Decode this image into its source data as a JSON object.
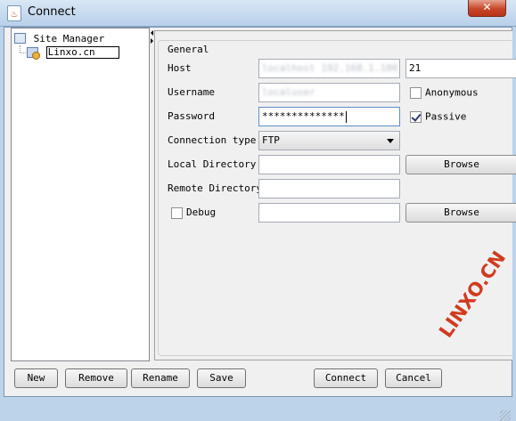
{
  "window": {
    "title": "Connect",
    "close_glyph": "✕",
    "app_icon": "java-cup-icon"
  },
  "tree": {
    "root": {
      "label": "Site Manager",
      "icon": "site-manager-icon"
    },
    "children": [
      {
        "label": "Linxo.cn",
        "icon": "site-icon"
      }
    ]
  },
  "form": {
    "group_title": "General",
    "host": {
      "label": "Host",
      "value": "localhost 192.168.1.100",
      "blurred": true,
      "port": "21"
    },
    "username": {
      "label": "Username",
      "value": "localuser",
      "blurred": true
    },
    "anonymous": {
      "label": "Anonymous",
      "checked": false
    },
    "password": {
      "label": "Password",
      "value": "**************"
    },
    "passive": {
      "label": "Passive",
      "checked": true
    },
    "connection_type": {
      "label": "Connection type",
      "value": "FTP"
    },
    "local_directory": {
      "label": "Local Directory",
      "value": "",
      "browse_label": "Browse"
    },
    "remote_directory": {
      "label": "Remote Directory",
      "value": ""
    },
    "debug": {
      "label": "Debug",
      "checked": false,
      "value": "",
      "browse_label": "Browse"
    }
  },
  "buttons": {
    "new": "New",
    "remove": "Remove",
    "rename": "Rename",
    "save": "Save",
    "connect": "Connect",
    "cancel": "Cancel"
  },
  "watermark": "LINXO.CN",
  "colors": {
    "watermark": "#d23a1e",
    "close_button": "#c7472a",
    "title_bar": "#b8d0ea"
  }
}
